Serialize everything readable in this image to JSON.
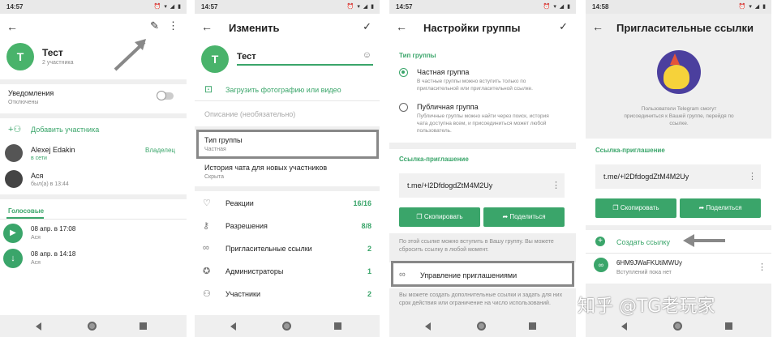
{
  "status": {
    "t1": "14:57",
    "t2": "14:57",
    "t3": "14:57",
    "t4": "14:58",
    "icons": "⏰ ▾ ◢ ▮"
  },
  "s1": {
    "title": "Тест",
    "members": "2 участника",
    "notif_label": "Уведомления",
    "notif_state": "Отключены",
    "add_member": "Добавить участника",
    "m1_name": "Alexej Edakin",
    "m1_status": "в сети",
    "m1_role": "Владелец",
    "m2_name": "Ася",
    "m2_status": "был(а) в 13:44",
    "voice_tab": "Голосовые",
    "v1_date": "08 апр. в 17:08",
    "v1_who": "Ася",
    "v2_date": "08 апр. в 14:18",
    "v2_who": "Ася",
    "avatar": "Т"
  },
  "s2": {
    "title": "Изменить",
    "name_value": "Тест",
    "avatar": "Т",
    "upload": "Загрузить фотографию или видео",
    "desc_placeholder": "Описание (необязательно)",
    "type_label": "Тип группы",
    "type_value": "Частная",
    "history_label": "История чата для новых участников",
    "history_value": "Скрыта",
    "rows": [
      {
        "label": "Реакции",
        "count": "16/16"
      },
      {
        "label": "Разрешения",
        "count": "8/8"
      },
      {
        "label": "Пригласительные ссылки",
        "count": "2"
      },
      {
        "label": "Администраторы",
        "count": "1"
      },
      {
        "label": "Участники",
        "count": "2"
      }
    ]
  },
  "s3": {
    "title": "Настройки группы",
    "section": "Тип группы",
    "private_label": "Частная группа",
    "private_desc": "В частные группы можно вступить только по пригласительной или пригласительной ссылке.",
    "public_label": "Публичная группа",
    "public_desc": "Публичные группы можно найти через поиск, история чата доступна всем, и присоединиться может любой пользователь.",
    "link_section": "Ссылка-приглашение",
    "link": "t.me/+l2DfdogdZtM4M2Uy",
    "copy": "Скопировать",
    "share": "Поделиться",
    "note": "По этой ссылке можно вступить в Вашу группу. Вы можете сбросить ссылку в любой момент.",
    "manage": "Управление приглашениями",
    "manage_note": "Вы можете создать дополнительные ссылки и задать для них срок действия или ограничение на число использований."
  },
  "s4": {
    "title": "Пригласительные ссылки",
    "desc": "Пользователи Telegram смогут присоединиться к Вашей группе, перейдя по ссылке.",
    "link_section": "Ссылка-приглашение",
    "link": "t.me/+l2DfdogdZtM4M2Uy",
    "copy": "Скопировать",
    "share": "Поделиться",
    "create": "Создать ссылку",
    "link2": "6HM9JWaFKUtiMWUy",
    "link2_note": "Вступлений пока нет"
  },
  "watermark": "知乎 @TG老玩家",
  "colors": {
    "accent": "#3aa56a",
    "annotation": "#888888"
  }
}
